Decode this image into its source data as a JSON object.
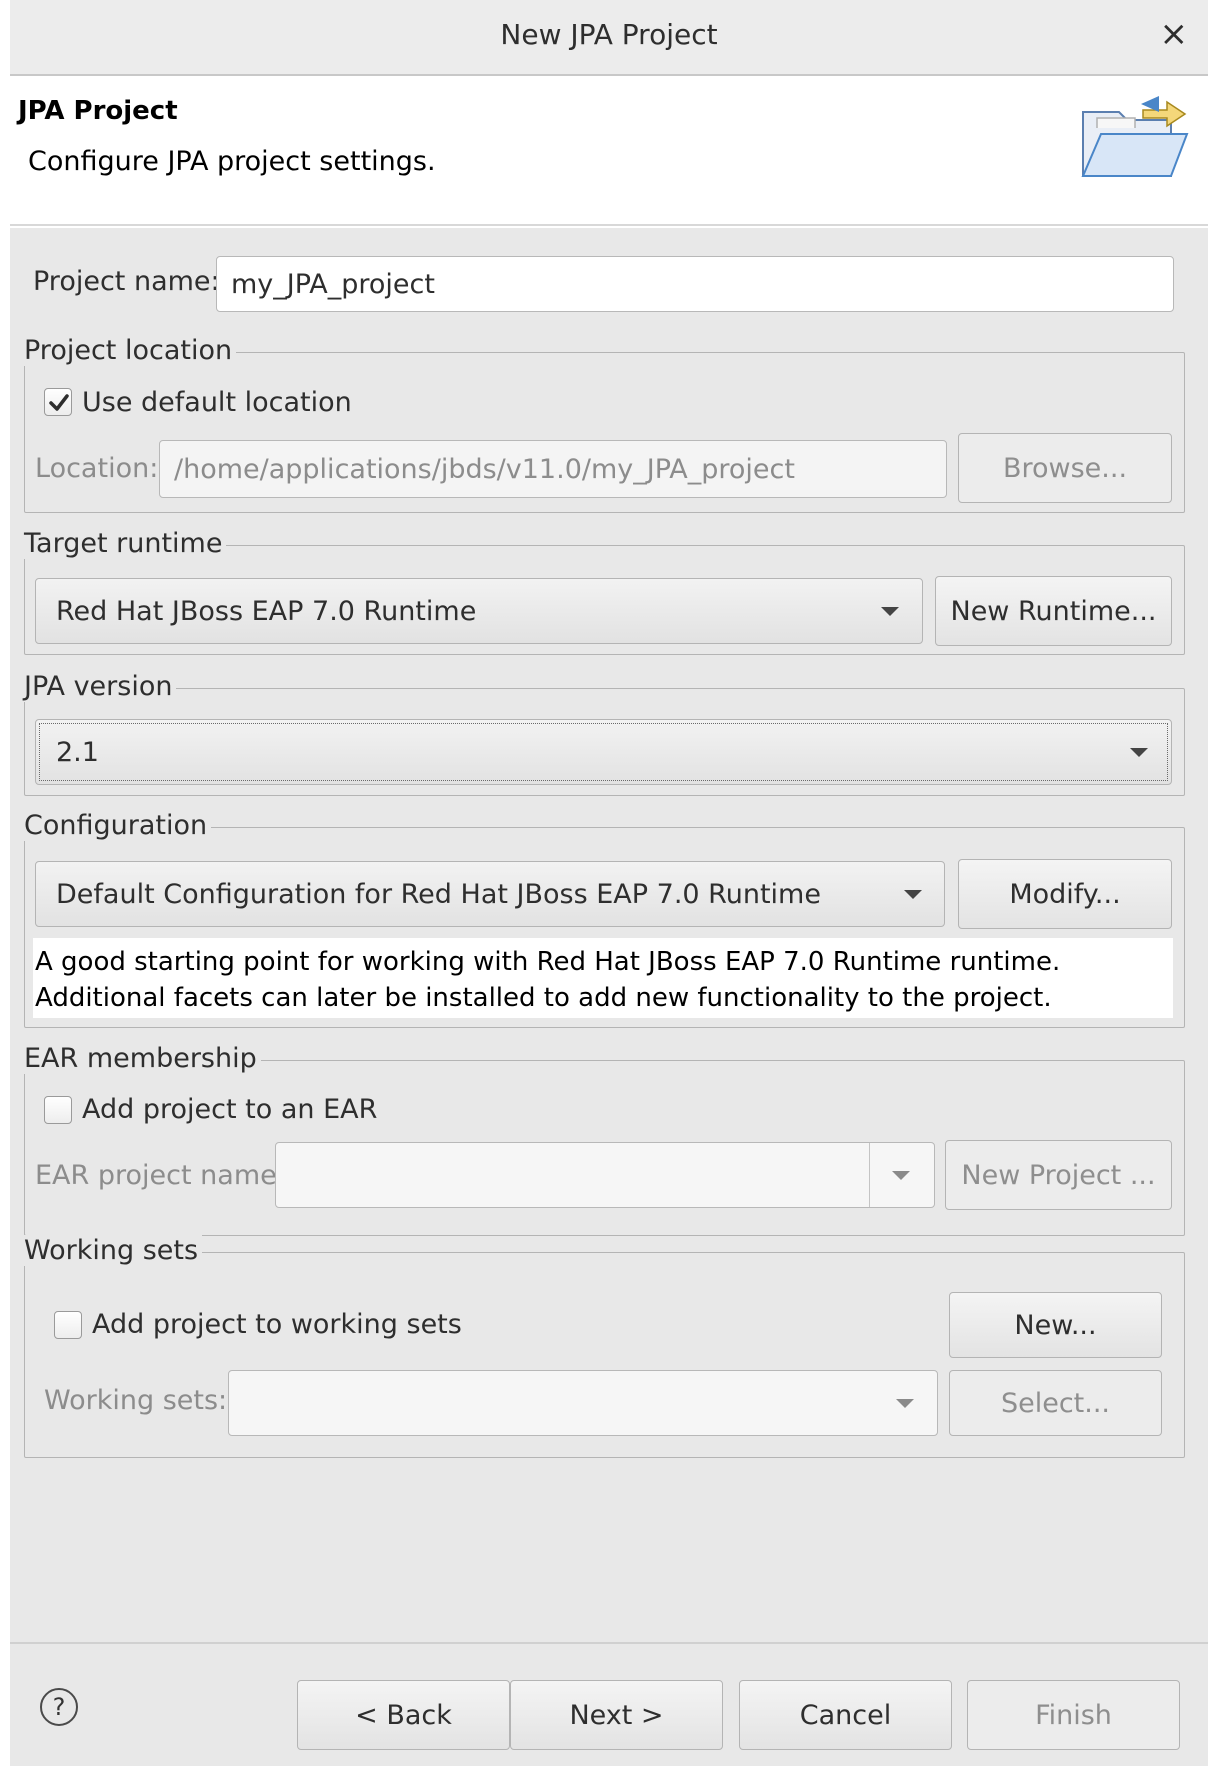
{
  "window": {
    "title": "New JPA Project",
    "close_glyph": "×"
  },
  "header": {
    "title": "JPA Project",
    "description": "Configure JPA project settings."
  },
  "project_name": {
    "label": "Project name:",
    "value": "my_JPA_project"
  },
  "project_location": {
    "legend": "Project location",
    "use_default_label": "Use default location",
    "use_default_checked": true,
    "location_label": "Location:",
    "location_value": "/home/applications/jbds/v11.0/my_JPA_project",
    "browse_label": "Browse..."
  },
  "target_runtime": {
    "legend": "Target runtime",
    "selected": "Red Hat JBoss EAP 7.0 Runtime",
    "new_runtime_label": "New Runtime..."
  },
  "jpa_version": {
    "legend": "JPA version",
    "selected": "2.1"
  },
  "configuration": {
    "legend": "Configuration",
    "selected": "Default Configuration for Red Hat JBoss EAP 7.0 Runtime",
    "modify_label": "Modify...",
    "description": "A good starting point for working with Red Hat JBoss EAP 7.0 Runtime runtime. Additional facets can later be installed to add new functionality to the project."
  },
  "ear_membership": {
    "legend": "EAR membership",
    "add_label": "Add project to an EAR",
    "add_checked": false,
    "name_label": "EAR project name:",
    "new_project_label": "New Project ..."
  },
  "working_sets": {
    "legend": "Working sets",
    "add_label": "Add project to working sets",
    "add_checked": false,
    "new_label": "New...",
    "sets_label": "Working sets:",
    "select_label": "Select..."
  },
  "footer": {
    "help_glyph": "?",
    "back_label": "< Back",
    "next_label": "Next >",
    "cancel_label": "Cancel",
    "finish_label": "Finish"
  },
  "colors": {
    "window_bg": "#e8e8e8",
    "titlebar_bg": "#ececec",
    "folder_blue": "#4a86c8",
    "folder_yellow": "#f4d77a"
  },
  "icons": {
    "header": "folder-open-icon",
    "close": "close-icon",
    "help": "help-icon",
    "dropdown": "chevron-down-icon",
    "check": "checkmark-icon"
  }
}
